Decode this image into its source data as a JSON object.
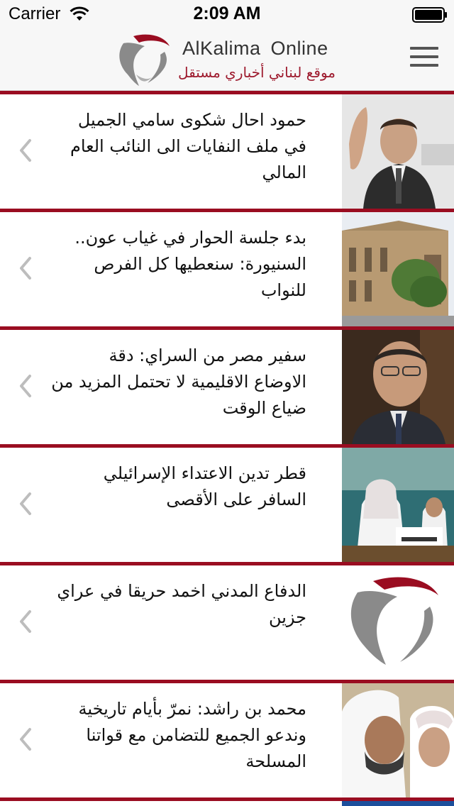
{
  "status_bar": {
    "carrier": "Carrier",
    "time": "2:09 AM",
    "icons": [
      "wifi-icon",
      "battery-icon"
    ]
  },
  "header": {
    "brand_name": "AlKalima  Online",
    "tagline": "موقع لبناني أخباري مستقل",
    "logo": "alkalima-logo",
    "menu_icon": "hamburger-menu-icon",
    "colors": {
      "brand_red": "#9a0d21",
      "brand_grey": "#888888"
    }
  },
  "news": [
    {
      "title": "حمود احال شكوى سامي الجميل في ملف النفايات الى النائب العام المالي",
      "thumbnail": "politician-waving-photo"
    },
    {
      "title": "بدء جلسة الحوار في غياب عون.. السنيورة: سنعطيها كل الفرص للنواب",
      "thumbnail": "parliament-building-photo"
    },
    {
      "title": "سفير مصر من السراي: دقة الاوضاع الاقليمية لا تحتمل المزيد من ضياع الوقت",
      "thumbnail": "ambassador-portrait-photo"
    },
    {
      "title": "قطر تدين الاعتداء الإسرائيلي السافر على الأقصى",
      "thumbnail": "conference-chairman-photo"
    },
    {
      "title": "الدفاع المدني اخمد حريقا في عراي جزين",
      "thumbnail": "alkalima-logo-placeholder"
    },
    {
      "title": "محمد بن راشد: نمرّ بأيام تاريخية وندعو الجميع للتضامن مع قواتنا المسلحة",
      "thumbnail": "leader-with-child-photo"
    }
  ]
}
